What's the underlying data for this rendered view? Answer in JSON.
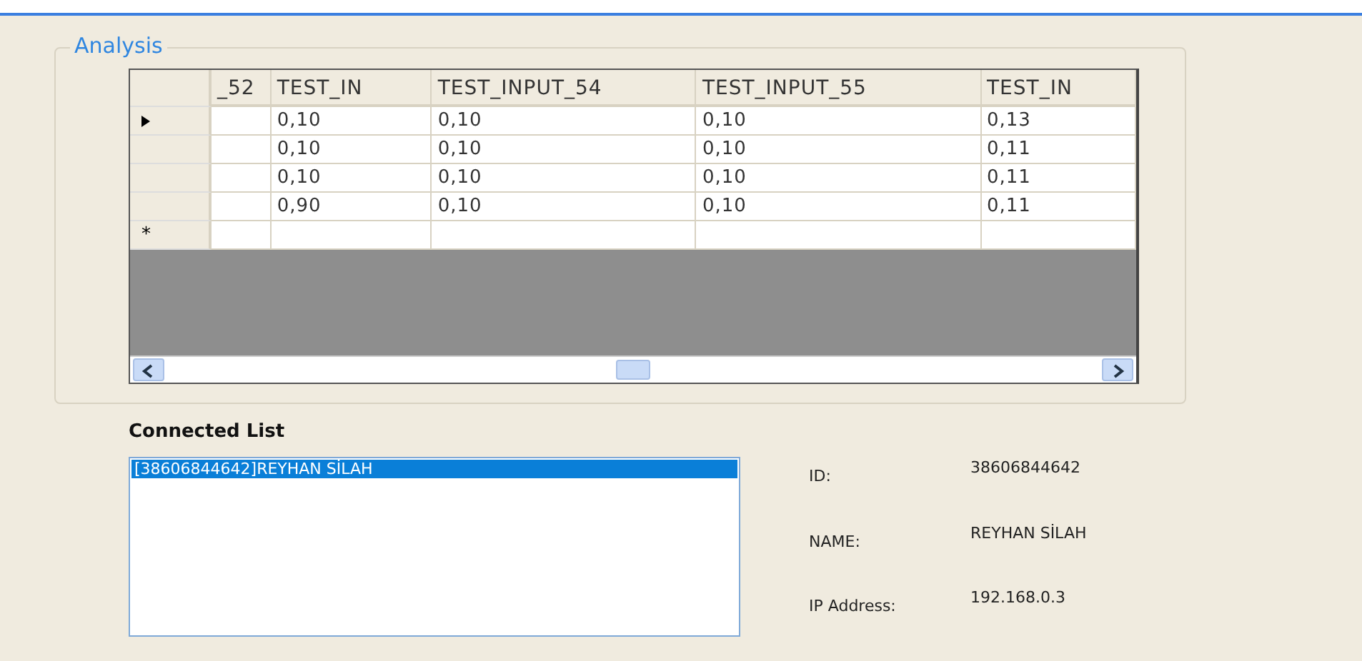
{
  "analysis": {
    "title": "Analysis",
    "table": {
      "columns": [
        "_52",
        "TEST_IN",
        "TEST_INPUT_54",
        "TEST_INPUT_55",
        "TEST_IN"
      ],
      "rows": [
        {
          "current": true,
          "cells": [
            "",
            "0,10",
            "0,10",
            "0,10",
            "0,13"
          ]
        },
        {
          "current": false,
          "cells": [
            "",
            "0,10",
            "0,10",
            "0,10",
            "0,11"
          ]
        },
        {
          "current": false,
          "cells": [
            "",
            "0,10",
            "0,10",
            "0,10",
            "0,11"
          ]
        },
        {
          "current": false,
          "cells": [
            "",
            "0,90",
            "0,10",
            "0,10",
            "0,11"
          ]
        }
      ],
      "new_row_marker": "*"
    }
  },
  "connected_list": {
    "title": "Connected List",
    "items": [
      {
        "label": "[38606844642]REYHAN SİLAH",
        "selected": true
      }
    ]
  },
  "details": [
    {
      "label": "ID:",
      "value": "38606844642"
    },
    {
      "label": "NAME:",
      "value": "REYHAN SİLAH"
    },
    {
      "label": "IP Address:",
      "value": "192.168.0.3"
    }
  ]
}
